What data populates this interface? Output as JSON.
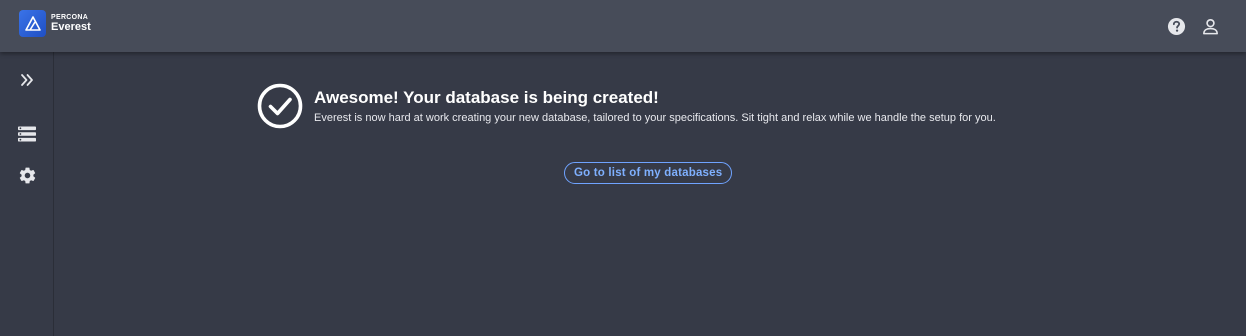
{
  "header": {
    "brand": "PERCONA",
    "product": "Everest",
    "icons": [
      "help-icon",
      "account-icon"
    ]
  },
  "sidebar": {
    "icons": [
      "expand-double-chevron-icon",
      "databases-list-icon",
      "settings-gear-icon"
    ]
  },
  "main": {
    "title": "Awesome! Your database is being created!",
    "description": "Everest is now hard at work creating your new database, tailored to your specifications. Sit tight and relax while we handle the setup for you.",
    "button_label": "Go to list of my databases"
  },
  "colors": {
    "background": "#363a47",
    "topbar": "#474c59",
    "accent": "#6fa3ff",
    "logo": "#2f63d8"
  }
}
